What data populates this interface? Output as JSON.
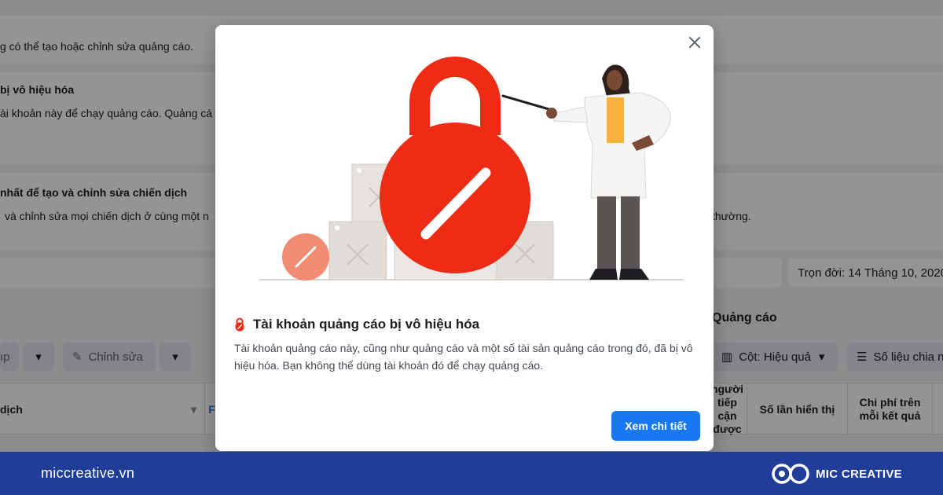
{
  "background": {
    "rows": [
      {
        "text": "g có thể tạo hoặc chỉnh sửa quảng cáo."
      },
      {
        "title": "bị vô hiệu hóa",
        "text": "ài khoản này để chạy quảng cáo. Quảng cá"
      },
      {
        "title": "nhất để tạo và chỉnh sửa chiến dịch",
        "text": "và chỉnh sửa mọi chiến dịch ở cùng một n",
        "text_right": "thường."
      }
    ],
    "date_range": "Trọn đời: 14 Tháng 10, 2020",
    "section_label": "Quảng cáo",
    "toolbar": {
      "left_partial": "ıp",
      "edit_label": "Chỉnh sửa",
      "columns_label": "Cột: Hiệu quả",
      "breakdown_label": "Số liệu chia n"
    },
    "table_headers": {
      "campaign": "dịch",
      "reach": "người\ntiếp cận\nđược",
      "impressions": "Số lần hiển thị",
      "cost_per_result": "Chi phí trên\nmỗi kết quả"
    }
  },
  "modal": {
    "title": "Tài khoản quảng cáo bị vô hiệu hóa",
    "description": "Tài khoản quảng cáo này, cũng như quảng cáo và một số tài sản quảng cáo trong đó, đã bị vô hiệu hóa. Bạn không thể dùng tài khoản đó để chạy quảng cáo.",
    "button_label": "Xem chi tiết",
    "icons": {
      "close": "close-icon",
      "title": "lock-icon"
    },
    "colors": {
      "accent": "#1877f2",
      "lock_red": "#ee2b14"
    }
  },
  "footer": {
    "site": "miccreative.vn",
    "brand": "MIC CREATIVE",
    "color": "#1f3d99"
  }
}
